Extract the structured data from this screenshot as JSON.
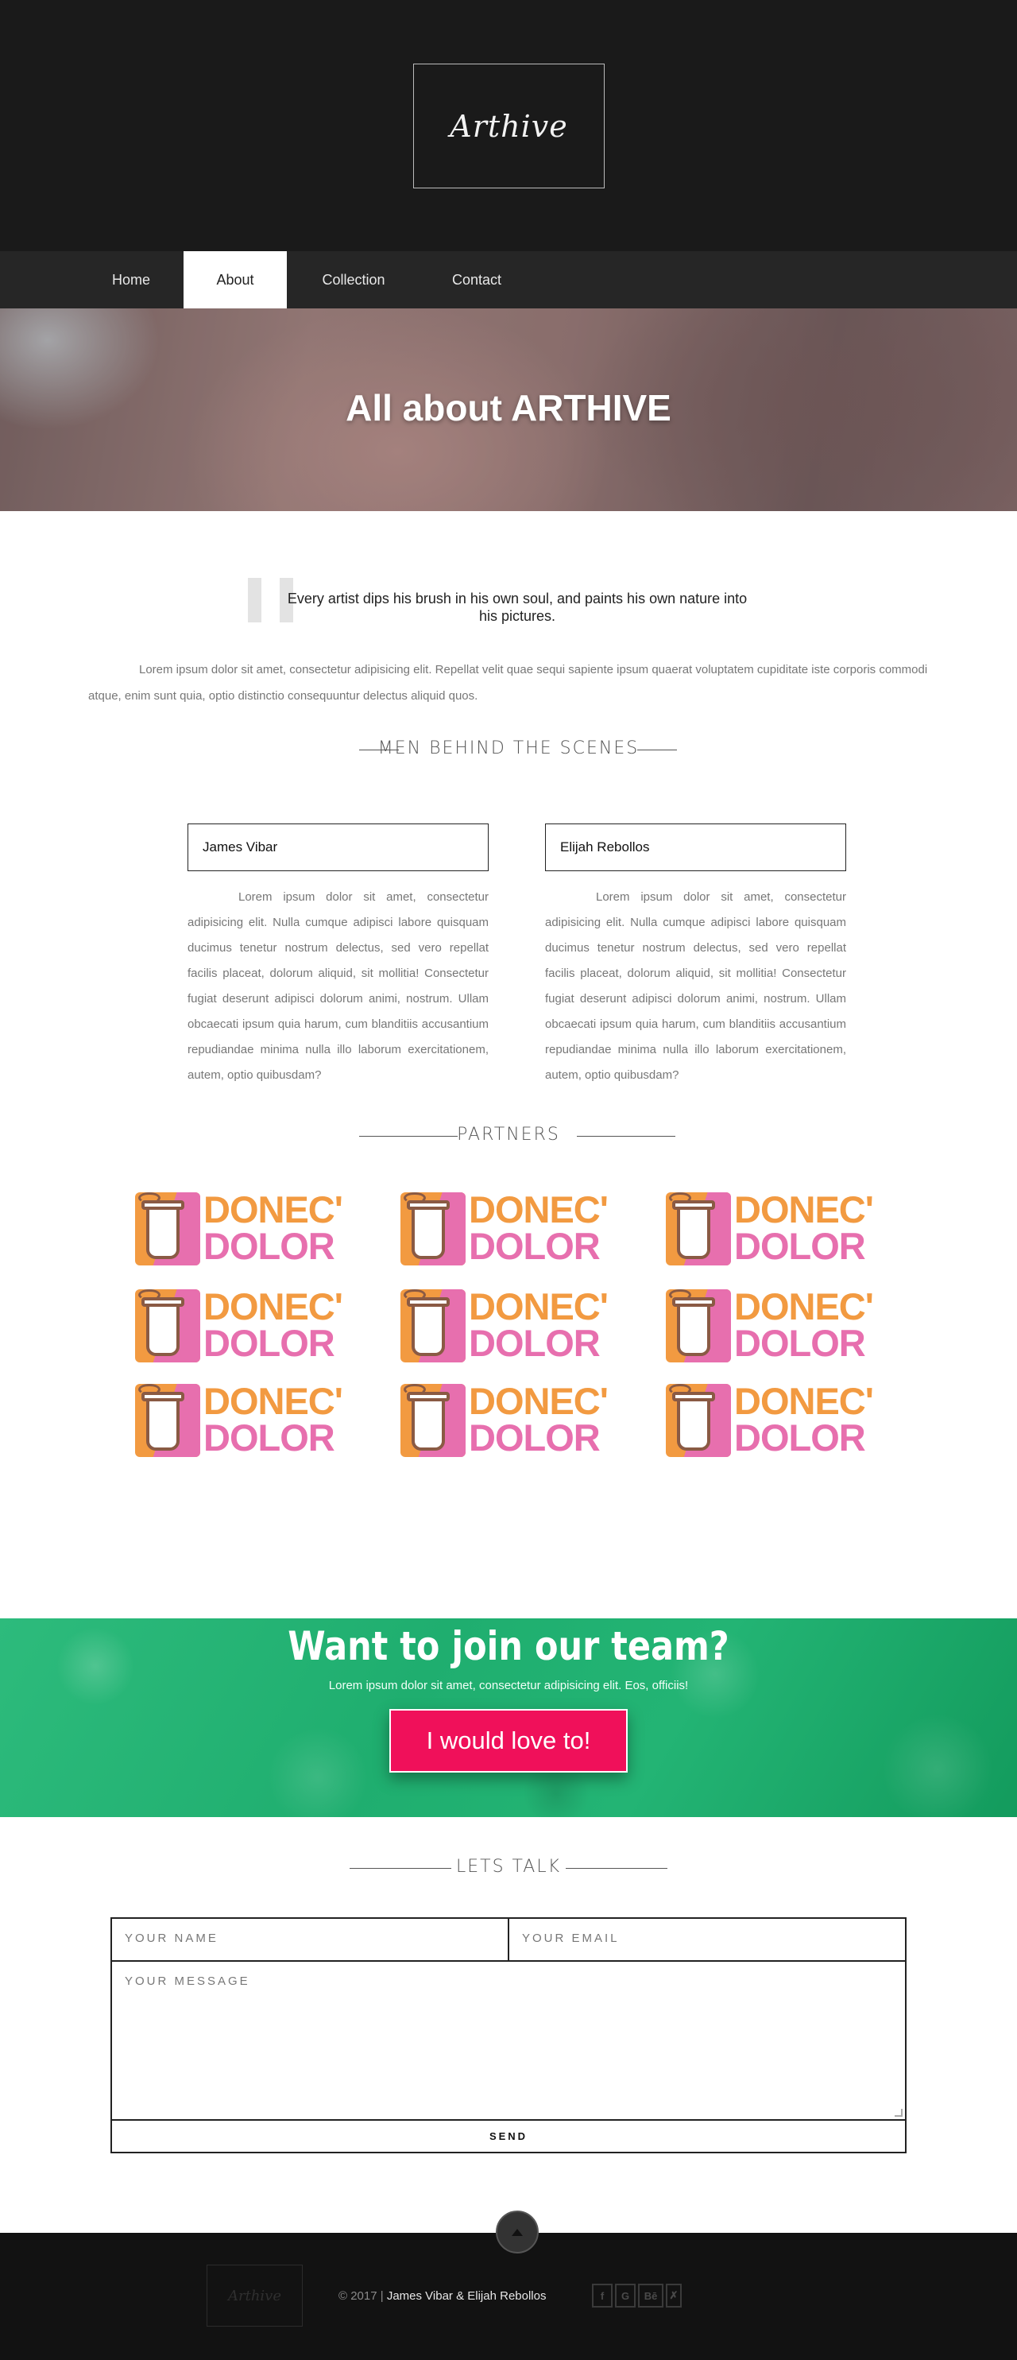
{
  "brand": {
    "logo_text": "Arthive"
  },
  "nav": {
    "items": [
      {
        "label": "Home"
      },
      {
        "label": "About",
        "active": true
      },
      {
        "label": "Collection"
      },
      {
        "label": "Contact"
      }
    ]
  },
  "hero": {
    "title": "All about ARTHIVE"
  },
  "quote": {
    "text": "Every artist dips his brush in his own soul, and paints his own nature into his pictures."
  },
  "intro": {
    "text": "Lorem ipsum dolor sit amet, consectetur adipisicing elit. Repellat velit quae sequi sapiente ipsum quaerat voluptatem cupiditate iste corporis commodi atque, enim sunt quia, optio distinctio consequuntur delectus aliquid quos."
  },
  "team": {
    "heading": "MEN BEHIND THE SCENES",
    "members": [
      {
        "name": "James Vibar",
        "bio": "Lorem ipsum dolor sit amet, consectetur adipisicing elit. Nulla cumque adipisci labore quisquam ducimus tenetur nostrum delectus, sed vero repellat facilis placeat, dolorum aliquid, sit mollitia! Consectetur fugiat deserunt adipisci dolorum animi, nostrum. Ullam obcaecati ipsum quia harum, cum blanditiis accusantium repudiandae minima nulla illo laborum exercitationem, autem, optio quibusdam?"
      },
      {
        "name": "Elijah Rebollos",
        "bio": "Lorem ipsum dolor sit amet, consectetur adipisicing elit. Nulla cumque adipisci labore quisquam ducimus tenetur nostrum delectus, sed vero repellat facilis placeat, dolorum aliquid, sit mollitia! Consectetur fugiat deserunt adipisci dolorum animi, nostrum. Ullam obcaecati ipsum quia harum, cum blanditiis accusantium repudiandae minima nulla illo laborum exercitationem, autem, optio quibusdam?"
      }
    ]
  },
  "partners": {
    "heading": "PARTNERS",
    "logo_word_1": "DONEC'",
    "logo_word_2": "DOLOR",
    "count": 9,
    "colors": {
      "orange": "#f29a41",
      "pink": "#e76fae",
      "brown": "#8a5a44"
    }
  },
  "join": {
    "title": "Want to join our team?",
    "subtitle": "Lorem ipsum dolor sit amet, consectetur adipisicing elit. Eos, officiis!",
    "button": "I would love to!",
    "colors": {
      "background": "#1fae6f",
      "button": "#f0105a"
    }
  },
  "contact": {
    "heading": "LETS TALK",
    "name_placeholder": "YOUR NAME",
    "email_placeholder": "YOUR EMAIL",
    "message_placeholder": "YOUR MESSAGE",
    "send": "SEND"
  },
  "footer": {
    "logo_text": "Arthive",
    "copyright": "© 2017 | ",
    "names": "James Vibar & Elijah Rebollos",
    "socials": [
      {
        "icon": "facebook-icon",
        "glyph": "f"
      },
      {
        "icon": "google-icon",
        "glyph": "G"
      },
      {
        "icon": "behance-icon",
        "glyph": "Bē"
      },
      {
        "icon": "x-icon",
        "glyph": "✗"
      }
    ]
  }
}
